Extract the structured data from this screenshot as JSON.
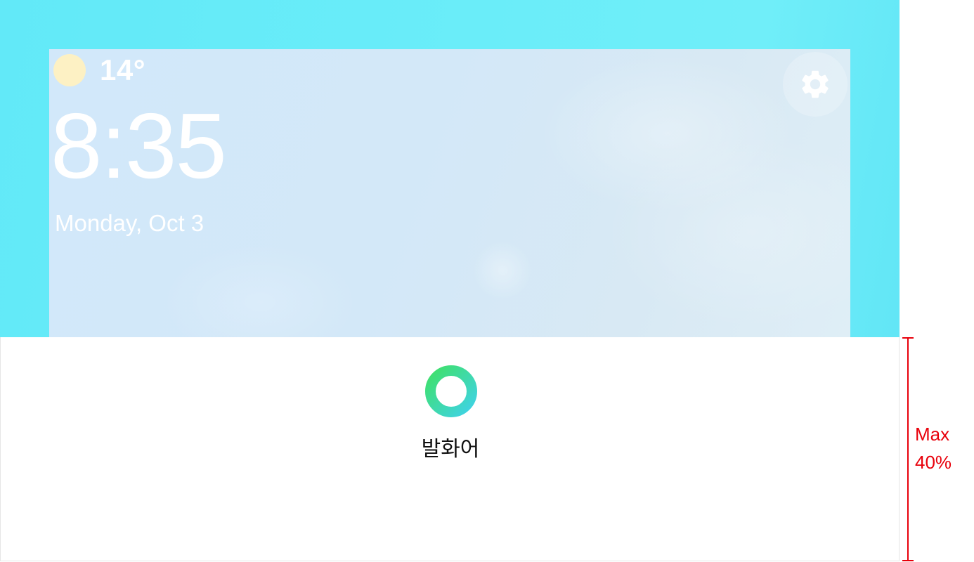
{
  "home_screen": {
    "weather": {
      "icon": "sun-icon",
      "temperature": "14°"
    },
    "clock": {
      "time": "8:35",
      "date": "Monday, Oct 3"
    },
    "settings": {
      "icon": "gear-icon"
    }
  },
  "voice_panel": {
    "indicator_icon": "voice-ring-icon",
    "label": "발화어",
    "gradient": [
      "#3fe06a",
      "#3fd3e6"
    ]
  },
  "annotation": {
    "line1": "Max",
    "line2": "40%",
    "color": "#e8000b"
  }
}
